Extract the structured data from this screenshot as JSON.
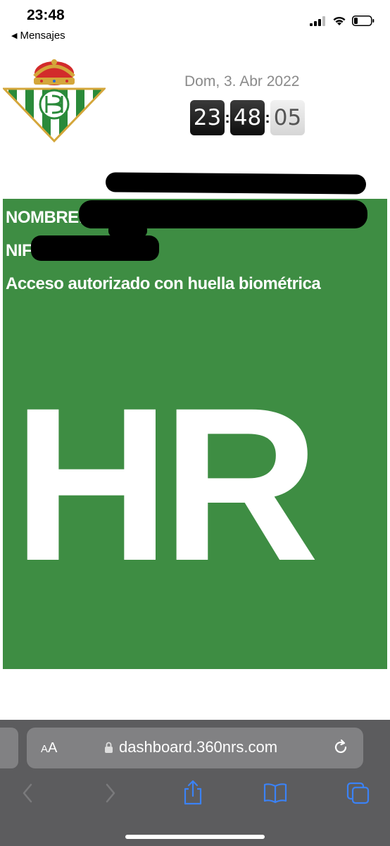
{
  "status_bar": {
    "time": "23:48",
    "back_label": "Mensajes"
  },
  "header": {
    "date": "Dom, 3. Abr 2022",
    "clock": {
      "hours": "23",
      "minutes": "48",
      "seconds": "05"
    }
  },
  "card": {
    "nombre_label": "NOMBRE:",
    "nif_label": "NIF:",
    "acceso_text": "Acceso autorizado con huella biométrica",
    "code": "HR",
    "background": "#3e8d43"
  },
  "browser": {
    "text_size_label_small": "A",
    "text_size_label_large": "A",
    "url": "dashboard.360nrs.com"
  },
  "colors": {
    "card_green": "#3e8d43",
    "safari_bar": "#5c5c5e",
    "toolbar_icon": "#3b82f6"
  }
}
